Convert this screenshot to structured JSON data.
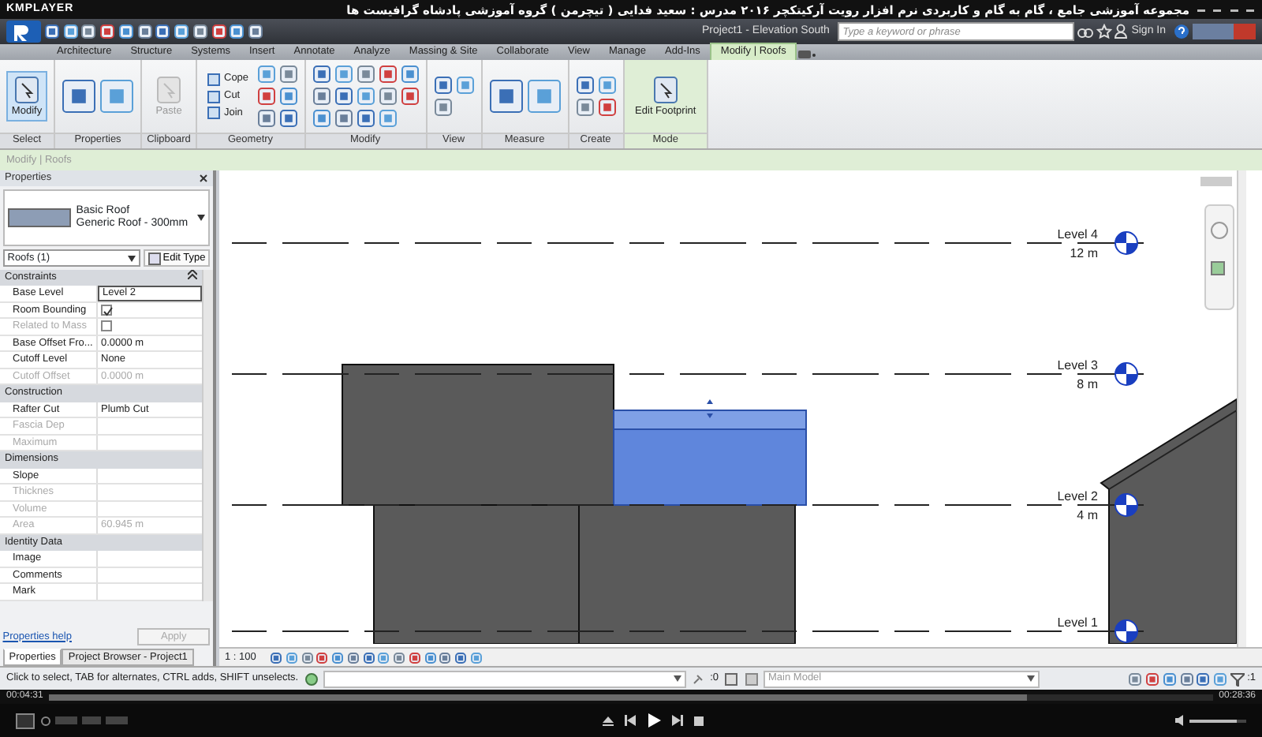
{
  "player": {
    "logo": "KMPLAYER",
    "title": "مجموعه آموزشی جامع ، گام به گام و کاربردی نرم افزار رویت آرکیتکچر ۲۰۱۶  مدرس : سعید فدایی ( تیچرمن ) گروه آموزشی پادشاه گرافیست ها",
    "elapsed": "00:04:31",
    "total": "00:28:36",
    "progress": {
      "level": 0.84
    },
    "volume": {
      "level": 0.82
    }
  },
  "app": {
    "title": "Project1 - Elevation South",
    "search": {
      "placeholder": "Type a keyword or phrase"
    },
    "sign_in": "Sign In"
  },
  "tabs": [
    {
      "label": "Architecture",
      "selected": false
    },
    {
      "label": "Structure",
      "selected": false
    },
    {
      "label": "Systems",
      "selected": false
    },
    {
      "label": "Insert",
      "selected": false
    },
    {
      "label": "Annotate",
      "selected": false
    },
    {
      "label": "Analyze",
      "selected": false
    },
    {
      "label": "Massing & Site",
      "selected": false
    },
    {
      "label": "Collaborate",
      "selected": false
    },
    {
      "label": "View",
      "selected": false
    },
    {
      "label": "Manage",
      "selected": false
    },
    {
      "label": "Add-Ins",
      "selected": false
    },
    {
      "label": "Modify | Roofs",
      "selected": true
    }
  ],
  "ribbon_panels": [
    {
      "label": "Select",
      "kind": "big",
      "tools": [
        {
          "label": "Modify",
          "selected": true,
          "disabled": false
        }
      ]
    },
    {
      "label": "Properties",
      "kind": "icons"
    },
    {
      "label": "Clipboard",
      "kind": "big",
      "tools": [
        {
          "label": "Paste",
          "selected": false,
          "disabled": true
        }
      ]
    },
    {
      "label": "Geometry",
      "kind": "small",
      "tools": [
        {
          "label": "Cope"
        },
        {
          "label": "Cut"
        },
        {
          "label": "Join"
        }
      ]
    },
    {
      "label": "Modify",
      "kind": "icons"
    },
    {
      "label": "View",
      "kind": "icons"
    },
    {
      "label": "Measure",
      "kind": "icons"
    },
    {
      "label": "Create",
      "kind": "icons"
    },
    {
      "label": "Mode",
      "kind": "big",
      "tools": [
        {
          "label": "Edit Footprint",
          "selected": false,
          "disabled": false
        }
      ]
    }
  ],
  "context_bar": "Modify | Roofs",
  "properties": {
    "title": "Properties",
    "type_name": "Basic Roof",
    "type_sub": "Generic Roof - 300mm",
    "filter": "Roofs (1)",
    "edit_type": "Edit Type",
    "sections": [
      {
        "label": "Constraints",
        "rows": [
          {
            "label": "Base Level",
            "kind": "text",
            "value": "Level 2",
            "disabled": false,
            "selected": true
          },
          {
            "label": "Room Bounding",
            "kind": "checkbox",
            "checked": true,
            "disabled": false,
            "selected": false
          },
          {
            "label": "Related to Mass",
            "kind": "checkbox",
            "checked": false,
            "disabled": true,
            "selected": false
          },
          {
            "label": "Base Offset Fro...",
            "kind": "text",
            "value": "0.0000 m",
            "disabled": false,
            "selected": false
          },
          {
            "label": "Cutoff Level",
            "kind": "text",
            "value": "None",
            "disabled": false,
            "selected": false
          },
          {
            "label": "Cutoff Offset",
            "kind": "text",
            "value": "0.0000 m",
            "disabled": true,
            "selected": false
          }
        ]
      },
      {
        "label": "Construction",
        "rows": [
          {
            "label": "Rafter Cut",
            "kind": "text",
            "value": "Plumb Cut",
            "disabled": false,
            "selected": false
          },
          {
            "label": "Fascia Dep",
            "kind": "text",
            "disabled": true,
            "selected": false
          },
          {
            "label": "Maximum",
            "kind": "text",
            "disabled": true,
            "selected": false
          }
        ]
      },
      {
        "label": "Dimensions",
        "rows": [
          {
            "label": "Slope",
            "kind": "text",
            "disabled": false,
            "selected": false
          },
          {
            "label": "Thicknes",
            "kind": "text",
            "disabled": true,
            "selected": false
          },
          {
            "label": "Volume",
            "kind": "text",
            "disabled": true,
            "selected": false
          },
          {
            "label": "Area",
            "kind": "text",
            "value": "60.945 m",
            "disabled": true,
            "selected": false
          }
        ]
      },
      {
        "label": "Identity Data",
        "rows": [
          {
            "label": "Image",
            "kind": "text",
            "disabled": false,
            "selected": false
          },
          {
            "label": "Comments",
            "kind": "text",
            "disabled": false,
            "selected": false
          },
          {
            "label": "Mark",
            "kind": "text",
            "disabled": false,
            "selected": false
          }
        ]
      }
    ],
    "help": "Properties help",
    "apply": {
      "label": "Apply",
      "disabled": true
    },
    "tabs": [
      {
        "label": "Properties",
        "selected": true
      },
      {
        "label": "Project Browser - Project1",
        "selected": false
      }
    ]
  },
  "view": {
    "levels": [
      {
        "name": "Level 4",
        "elevation": "12 m"
      },
      {
        "name": "Level 3",
        "elevation": "8 m"
      },
      {
        "name": "Level 2",
        "elevation": "4 m"
      },
      {
        "name": "Level 1"
      }
    ],
    "scale": "1 : 100"
  },
  "status_bar": {
    "message": "Click to select, TAB for alternates, CTRL adds, SHIFT unselects.",
    "selection_count": ":0",
    "workset": "Main Model",
    "filter_count": ":1"
  }
}
